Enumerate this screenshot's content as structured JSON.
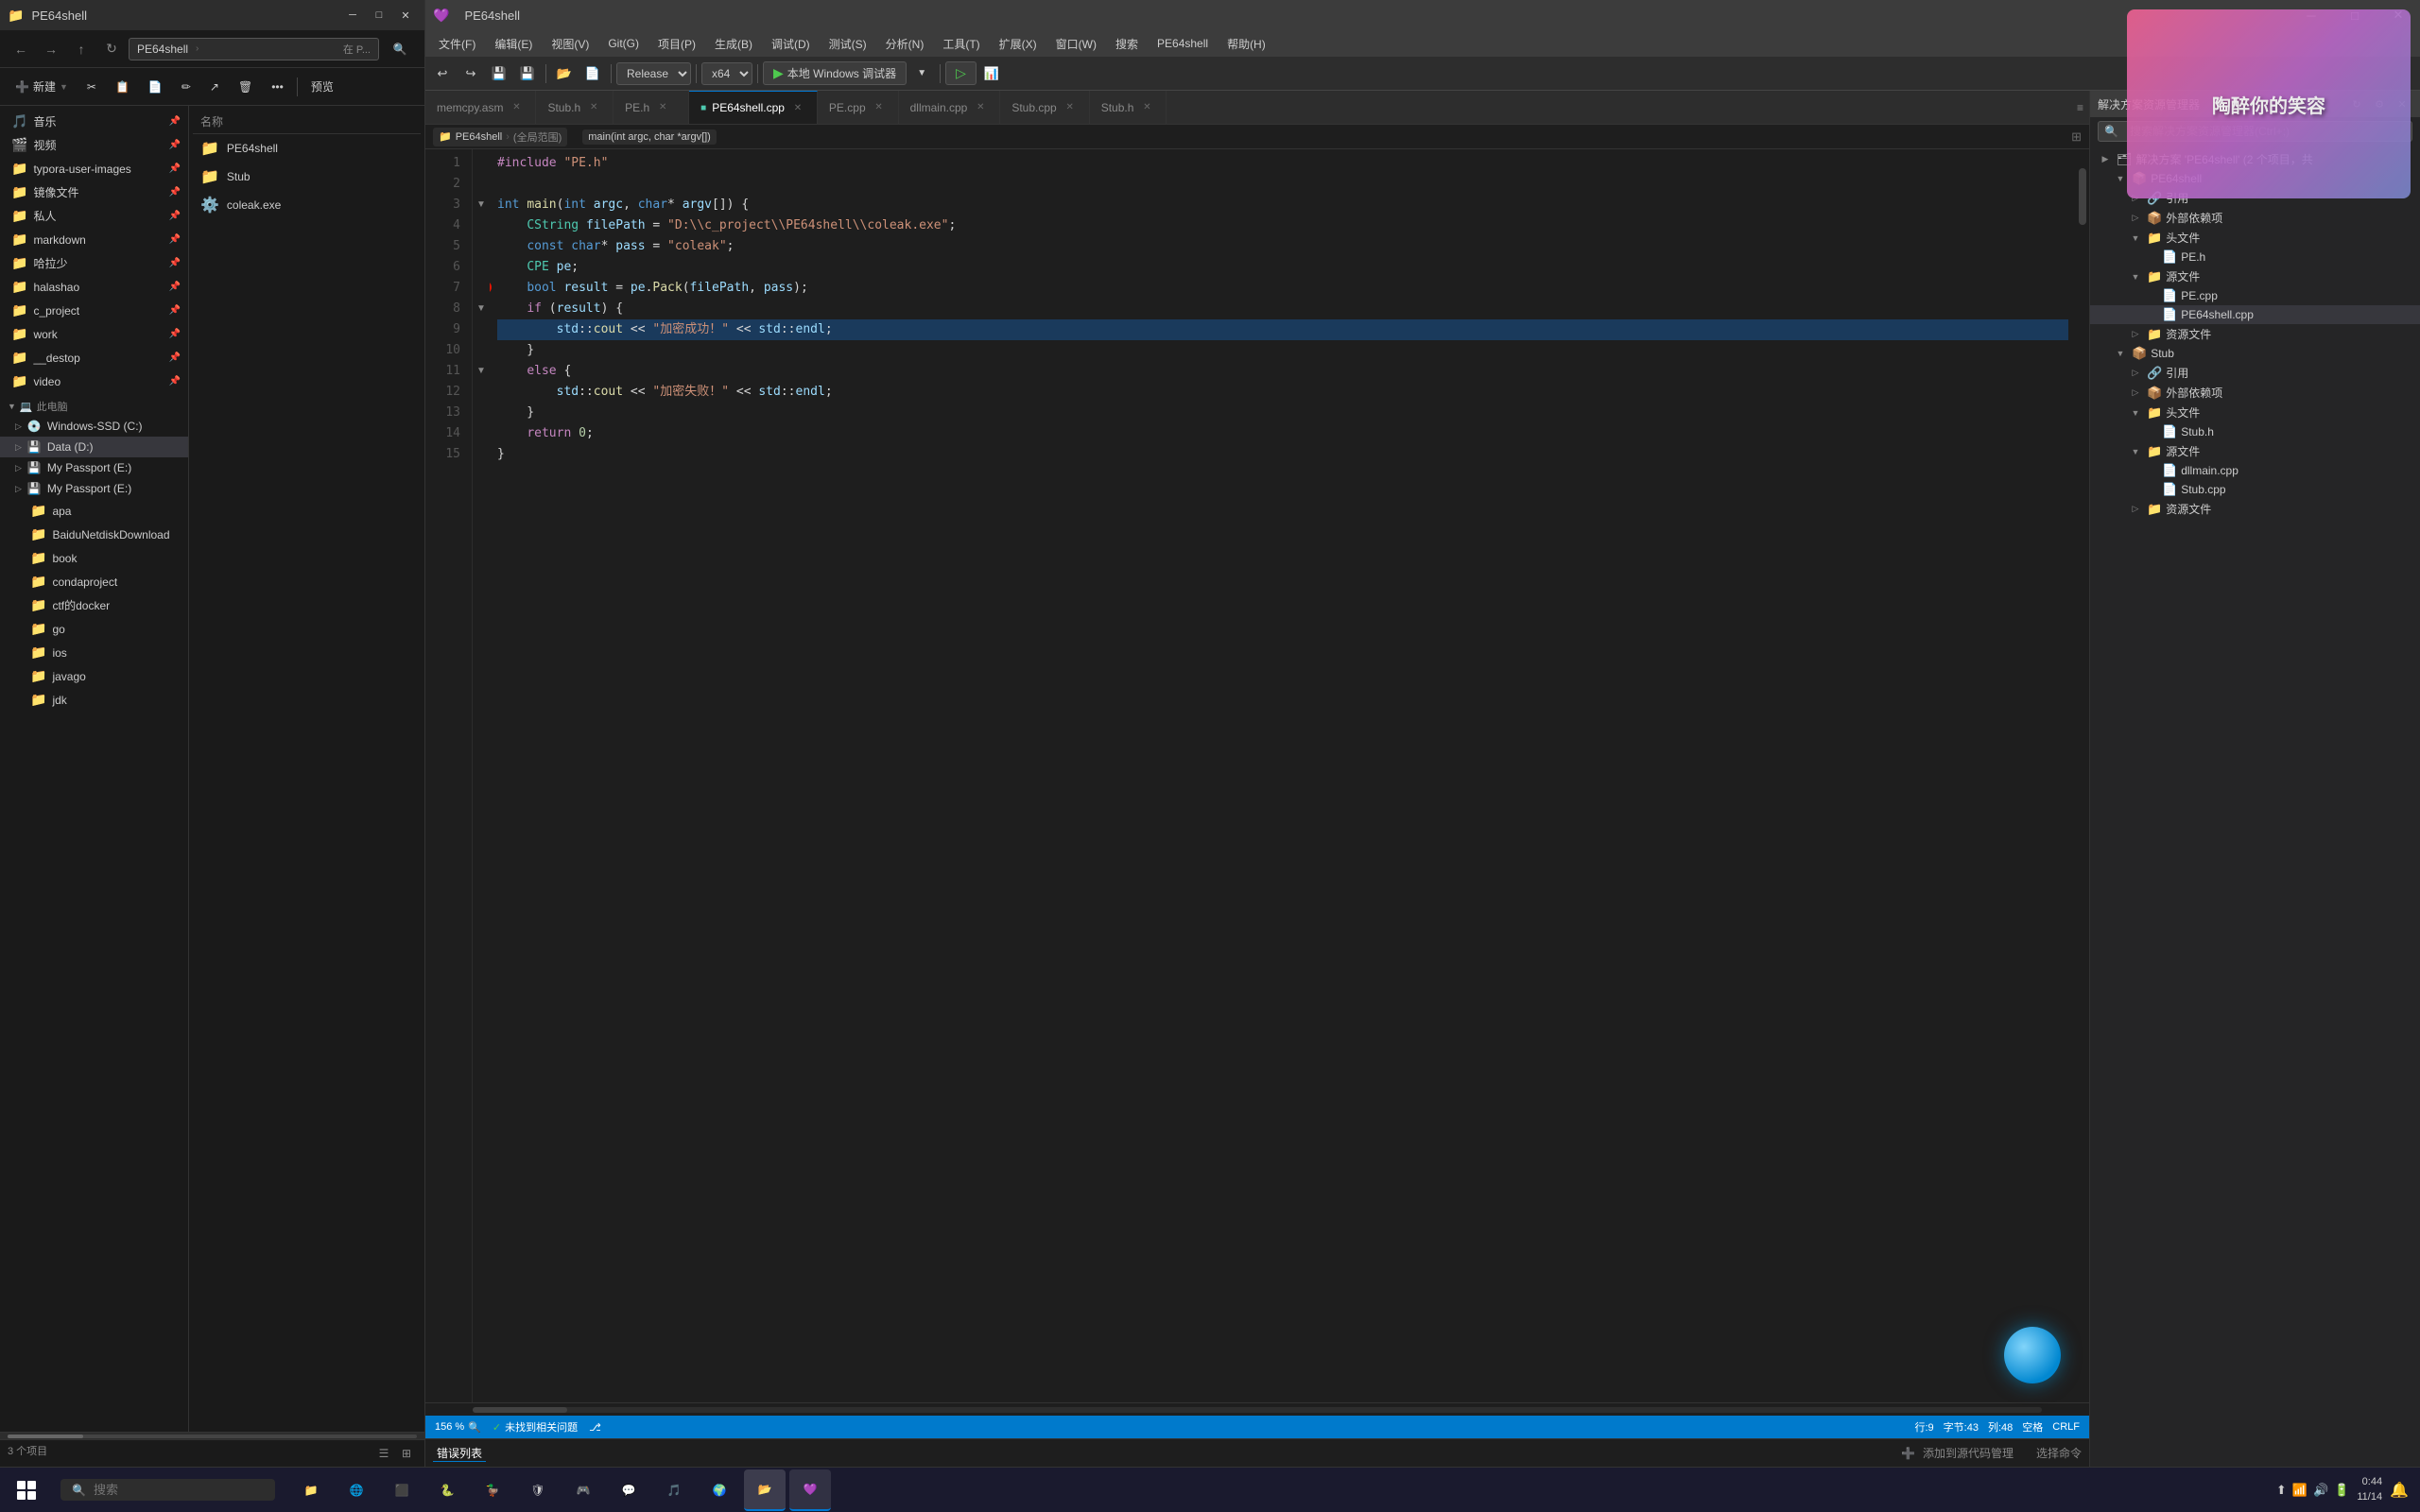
{
  "explorer": {
    "title": "PE64shell",
    "nav": {
      "path": "PE64shell",
      "location": "在 P..."
    },
    "toolbar": {
      "new_label": "新建",
      "preview_label": "预览"
    },
    "sidebar": {
      "music": "音乐",
      "video": "视频",
      "typora": "typora-user-images",
      "mirror": "镜像文件",
      "private": "私人",
      "markdown": "markdown",
      "halala": "哈拉少",
      "halashao": "halashao",
      "c_project": "c_project",
      "work": "work",
      "destop": "__destop",
      "video2": "video",
      "this_pc": "此电脑",
      "windows_ssd": "Windows-SSD (C:)",
      "data_d": "Data (D:)",
      "my_passport_e1": "My Passport (E:)",
      "my_passport_e2": "My Passport (E:)",
      "apa": "apa",
      "baidu": "BaiduNetdiskDownload",
      "book": "book",
      "condaproject": "condaproject",
      "ctf_docker": "ctf的docker",
      "go": "go",
      "ios": "ios",
      "javago": "javago",
      "jdk": "jdk"
    },
    "files": {
      "header": "名称",
      "items": [
        {
          "name": "PE64shell",
          "icon": "📁",
          "type": "folder"
        },
        {
          "name": "Stub",
          "icon": "📁",
          "type": "folder"
        },
        {
          "name": "coleak.exe",
          "icon": "⚙️",
          "type": "file"
        }
      ]
    },
    "statusbar": {
      "count": "3 个项目"
    }
  },
  "vs": {
    "title": "PE64shell",
    "menubar": {
      "items": [
        "文件(F)",
        "编辑(E)",
        "视图(V)",
        "Git(G)",
        "项目(P)",
        "生成(B)",
        "调试(D)",
        "测试(S)",
        "分析(N)",
        "工具(T)",
        "扩展(X)",
        "窗口(W)",
        "搜索",
        "PE64shell",
        "帮助(H)"
      ]
    },
    "toolbar": {
      "config": "Release",
      "platform": "x64",
      "run_label": "本地 Windows 调试器",
      "run_label2": "▶"
    },
    "tabs": {
      "items": [
        {
          "label": "memcpy.asm",
          "active": false
        },
        {
          "label": "Stub.h",
          "active": false
        },
        {
          "label": "PE.h",
          "active": false
        },
        {
          "label": "PE64shell.cpp",
          "active": true,
          "modified": false
        },
        {
          "label": "PE.cpp",
          "active": false
        },
        {
          "label": "dllmain.cpp",
          "active": false
        },
        {
          "label": "Stub.cpp",
          "active": false
        },
        {
          "label": "Stub.h",
          "active": false
        }
      ]
    },
    "breadcrumb": {
      "project": "PE64shell",
      "scope": "(全局范围)",
      "function": "main(int argc, char *argv[])"
    },
    "code": {
      "lines": [
        {
          "num": 1,
          "content": "#include \"PE.h\"",
          "type": "include"
        },
        {
          "num": 2,
          "content": "",
          "type": "blank"
        },
        {
          "num": 3,
          "content": "int main(int argc, char* argv[]) {",
          "type": "code",
          "fold": "▼"
        },
        {
          "num": 4,
          "content": "    CString filePath = \"D:\\\\c_project\\\\PE64shell\\\\coleak.exe\";",
          "type": "code"
        },
        {
          "num": 5,
          "content": "    const char* pass = \"coleak\";",
          "type": "code"
        },
        {
          "num": 6,
          "content": "    CPE pe;",
          "type": "code"
        },
        {
          "num": 7,
          "content": "    bool result = pe.Pack(filePath, pass);",
          "type": "code",
          "breakpoint": true
        },
        {
          "num": 8,
          "content": "    if (result) {",
          "type": "code",
          "fold": "▼"
        },
        {
          "num": 9,
          "content": "        std::cout << \"加密成功！\" << std::endl;",
          "type": "code",
          "active": true
        },
        {
          "num": 10,
          "content": "    }",
          "type": "code"
        },
        {
          "num": 11,
          "content": "    else {",
          "type": "code",
          "fold": "▼"
        },
        {
          "num": 12,
          "content": "        std::cout << \"加密失败！\" << std::endl;",
          "type": "code"
        },
        {
          "num": 13,
          "content": "    }",
          "type": "code"
        },
        {
          "num": 14,
          "content": "    return 0;",
          "type": "code"
        },
        {
          "num": 15,
          "content": "}",
          "type": "code"
        }
      ]
    },
    "statusbar": {
      "zoom": "156 %",
      "errors": "未找到相关问题",
      "row": "行:9",
      "col": "字节:43",
      "chars": "列:48",
      "space": "空格",
      "encoding": "CRLF"
    },
    "panel": {
      "label": "错误列表"
    },
    "solution": {
      "title": "解决方案资源管理器",
      "search_placeholder": "搜索解决方案资源管理器(Ctrl+;)",
      "root": "解决方案 'PE64shell' (2 个项目，共",
      "tree": [
        {
          "label": "PE64shell",
          "icon": "📁",
          "level": 1,
          "expanded": true
        },
        {
          "label": "引用",
          "icon": "🔗",
          "level": 2
        },
        {
          "label": "外部依赖项",
          "icon": "📦",
          "level": 2
        },
        {
          "label": "头文件",
          "icon": "📁",
          "level": 2,
          "expanded": true
        },
        {
          "label": "PE.h",
          "icon": "📄",
          "level": 3
        },
        {
          "label": "源文件",
          "icon": "📁",
          "level": 2,
          "expanded": true
        },
        {
          "label": "PE.cpp",
          "icon": "📄",
          "level": 3
        },
        {
          "label": "PE64shell.cpp",
          "icon": "📄",
          "level": 3
        },
        {
          "label": "资源文件",
          "icon": "📁",
          "level": 2
        },
        {
          "label": "Stub",
          "icon": "📁",
          "level": 1,
          "expanded": true
        },
        {
          "label": "引用",
          "icon": "🔗",
          "level": 2
        },
        {
          "label": "外部依赖项",
          "icon": "📦",
          "level": 2
        },
        {
          "label": "头文件",
          "icon": "📁",
          "level": 2,
          "expanded": true
        },
        {
          "label": "Stub.h",
          "icon": "📄",
          "level": 3
        },
        {
          "label": "源文件",
          "icon": "📁",
          "level": 2,
          "expanded": true
        },
        {
          "label": "dllmain.cpp",
          "icon": "📄",
          "level": 3
        },
        {
          "label": "Stub.cpp",
          "icon": "📄",
          "level": 3
        },
        {
          "label": "资源文件",
          "icon": "📁",
          "level": 2
        }
      ]
    }
  },
  "overlay": {
    "text": "陶醉你的笑容"
  },
  "taskbar": {
    "search_placeholder": "搜索",
    "clock": {
      "time": "0:44",
      "date": "11/14"
    },
    "apps": [
      "🪟",
      "🌐",
      "📁",
      "💻",
      "🎮",
      "🔧",
      "🎵",
      "📧"
    ]
  }
}
